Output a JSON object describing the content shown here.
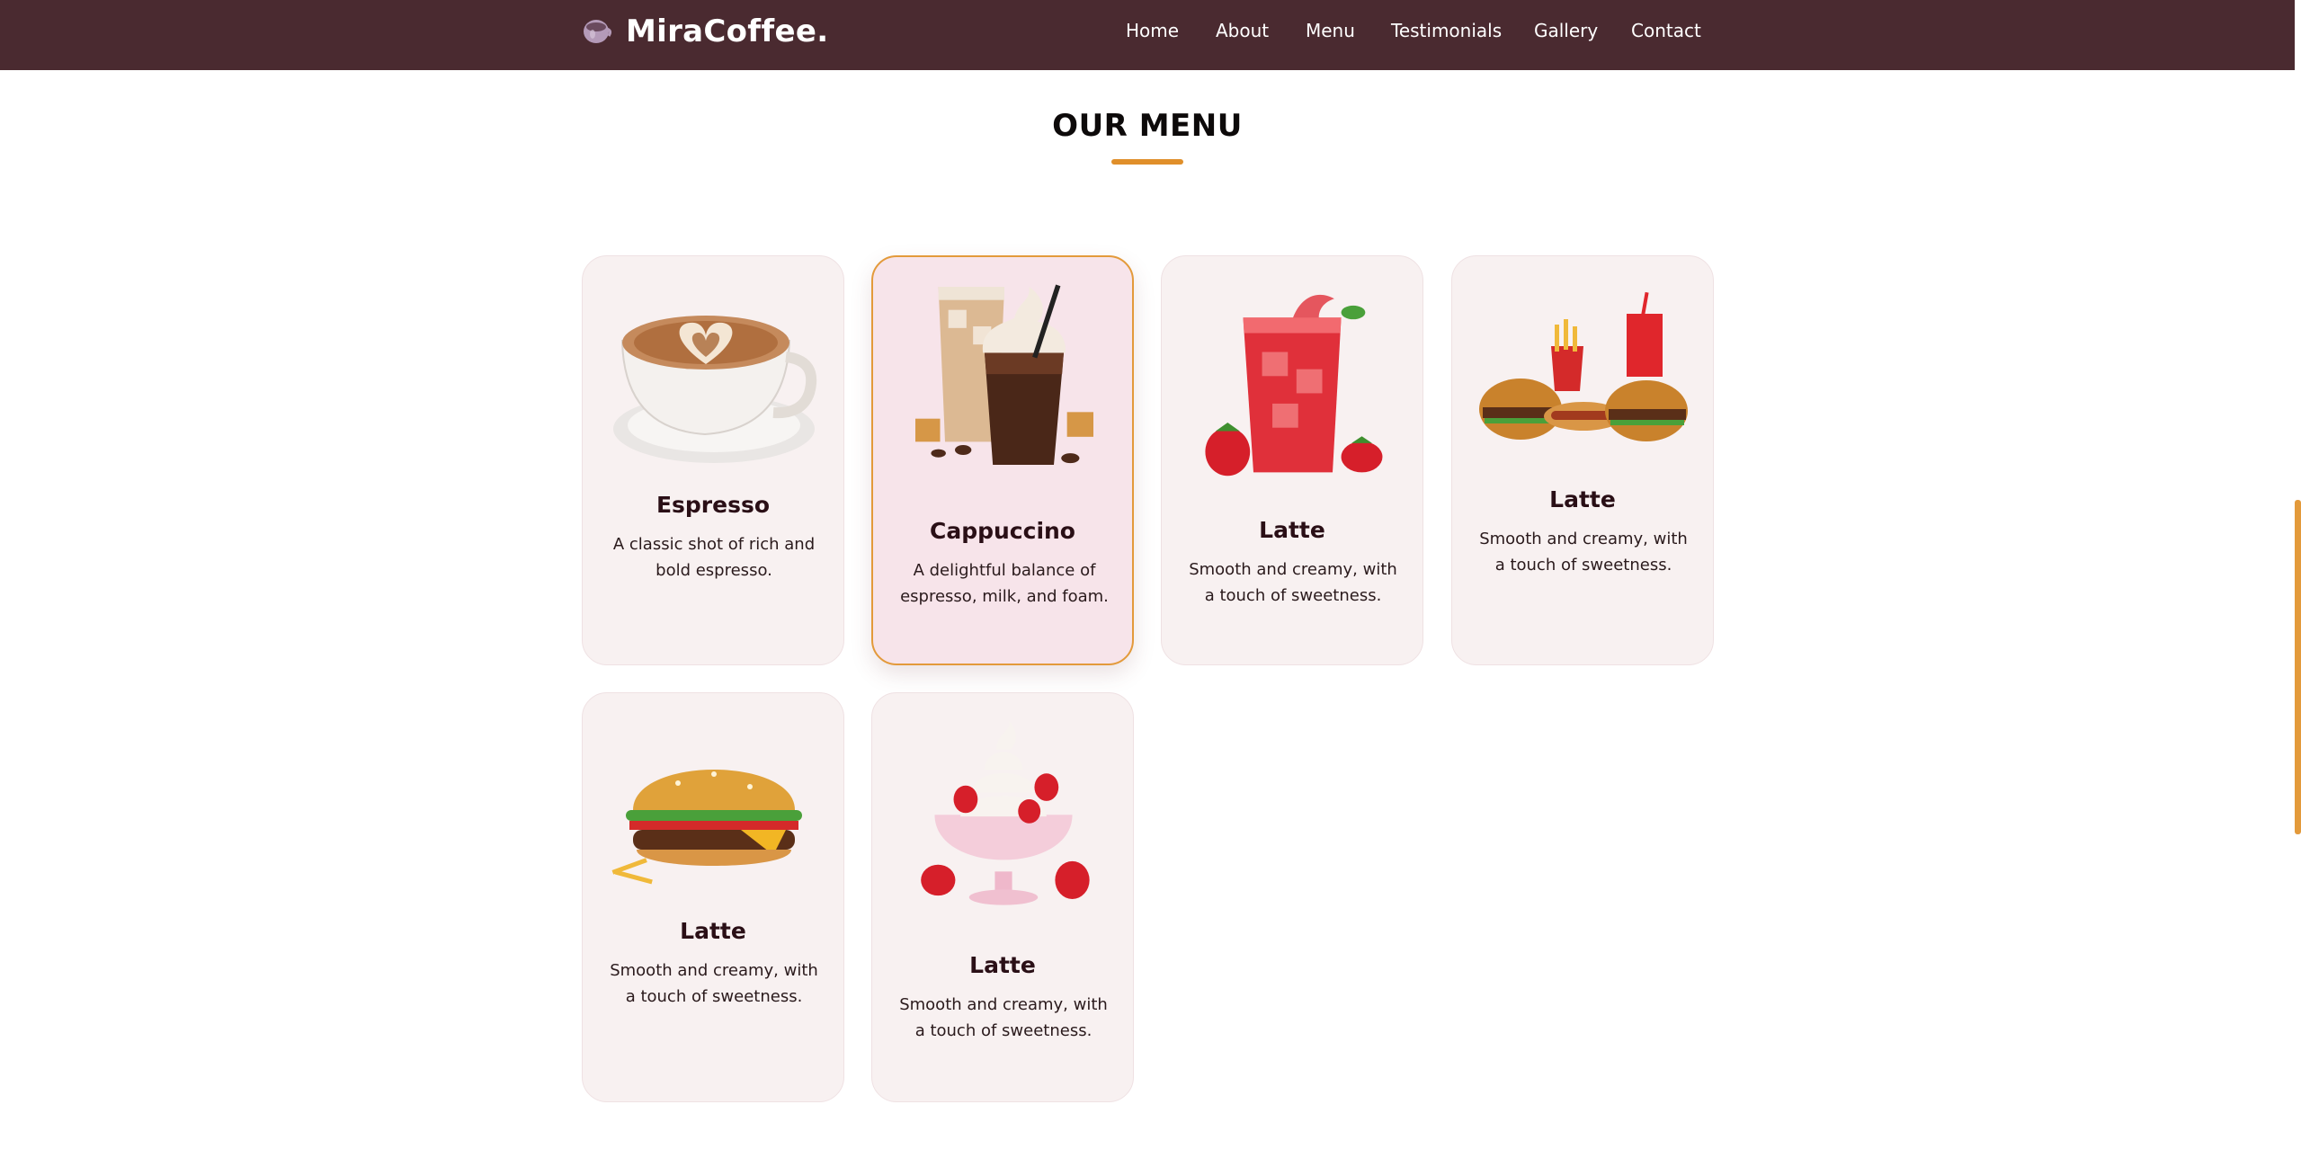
{
  "brand": {
    "name": "MiraCoffee.",
    "logo_icon": "coffee-cup-icon"
  },
  "nav": {
    "items": [
      {
        "label": "Home"
      },
      {
        "label": "About"
      },
      {
        "label": "Menu"
      },
      {
        "label": "Testimonials"
      },
      {
        "label": "Gallery"
      },
      {
        "label": "Contact"
      }
    ]
  },
  "menu_section": {
    "title": "OUR MENU",
    "accent_color": "#e08f2a",
    "items": [
      {
        "title": "Espresso",
        "description": "A classic shot of rich and bold espresso.",
        "image": "latte-art-cup-image",
        "selected": false
      },
      {
        "title": "Cappuccino",
        "description": "A delightful balance of espresso, milk, and foam.",
        "image": "iced-coffee-drinks-image",
        "selected": true
      },
      {
        "title": "Latte",
        "description": "Smooth and creamy, with a touch of sweetness.",
        "image": "strawberry-drink-image",
        "selected": false
      },
      {
        "title": "Latte",
        "description": "Smooth and creamy, with a touch of sweetness.",
        "image": "fast-food-combo-image",
        "selected": false
      },
      {
        "title": "Latte",
        "description": "Smooth and creamy, with a touch of sweetness.",
        "image": "burger-image",
        "selected": false
      },
      {
        "title": "Latte",
        "description": "Smooth and creamy, with a touch of sweetness.",
        "image": "strawberry-sundae-image",
        "selected": false
      }
    ]
  },
  "colors": {
    "header_bg": "#4a2a30",
    "card_bg": "#f8f1f1",
    "card_selected_border": "#e39a3b"
  }
}
